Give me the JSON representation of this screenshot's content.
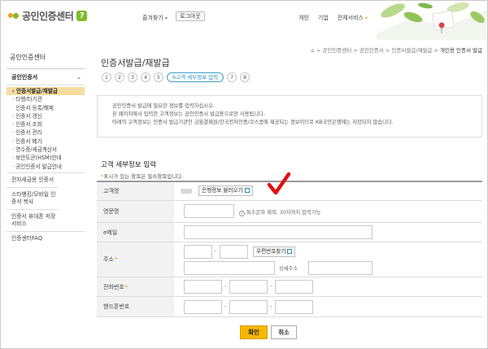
{
  "header": {
    "logo_text": "공인인증센터",
    "help_label": "?",
    "favorites_label": "즐겨찾기",
    "logout_label": "로그아웃",
    "nav": [
      "개인",
      "기업",
      "전체서비스"
    ]
  },
  "sidebar": {
    "title": "공인인증센터",
    "section_label": "공인인증서",
    "sub_items": [
      {
        "label": "인증서발급/재발급",
        "active": true
      },
      {
        "label": "타행/타기관",
        "active": false
      },
      {
        "label": "인증서 등록/해제",
        "active": false
      },
      {
        "label": "인증서 갱신",
        "active": false
      },
      {
        "label": "인증서 조회",
        "active": false
      },
      {
        "label": "인증서 관리",
        "active": false
      },
      {
        "label": "인증서 폐기",
        "active": false
      },
      {
        "label": "영수증/세금계산서",
        "active": false
      },
      {
        "label": "보안토큰(HSM)안내",
        "active": false
      },
      {
        "label": "공인인증서 발급안내",
        "active": false
      }
    ],
    "links": [
      "전자세금용 인증서",
      "스타뱅킹/모바일 인증서 복사",
      "인증서 휴대폰 저장서비스",
      "인증센터FAQ"
    ]
  },
  "content": {
    "breadcrumb": [
      "공인인증센터",
      "공인인증서",
      "인증서발급/재발급",
      "개인용 인증서 발급"
    ],
    "breadcrumb_sep": ">",
    "page_title": "인증서발급/재발급",
    "steps": [
      "1",
      "2",
      "3",
      "4",
      "5",
      "6고객 세부정보 입력",
      "7",
      "8"
    ],
    "current_step": 5,
    "notices": [
      "공인인증서 발급에 필요한 정보를 입력하십시오.",
      "본 페이지에서 입력한 고객정보는 공인인증서 발급용으로만 사용됩니다.",
      "아래의 고객정보는 인증서 발급기관인 금융결제원/한국전자인증/코스콤에 제공되는 정보이므로 KB국민은행에는 저장되지 않습니다."
    ],
    "section_title": "고객 세부정보 입력",
    "required_note_prefix": "*",
    "required_note": "표시가 있는 항목은 필수항목입니다.",
    "form": {
      "name_label": "고객명",
      "load_bank_info_btn": "은행정보 불러오기",
      "eng_name_label": "영문명",
      "eng_name_hint": "특수문자 제외, 30자까지 입력가능",
      "email_label": "e메일",
      "address_label": "주소",
      "zip_search_btn": "우편번호찾기",
      "detail_address_label": "상세주소",
      "phone_label": "전화번호",
      "mobile_label": "핸드폰번호",
      "dash": "-",
      "required_star": "*"
    },
    "confirm_btn": "확인",
    "cancel_btn": "취소"
  },
  "colors": {
    "accent_yellow": "#f5b800",
    "active_menu_bg": "#f6dca0",
    "step_current": "#2a8cb6",
    "checkmark_red": "#e01010",
    "logo_green": "#7cbb2e"
  }
}
